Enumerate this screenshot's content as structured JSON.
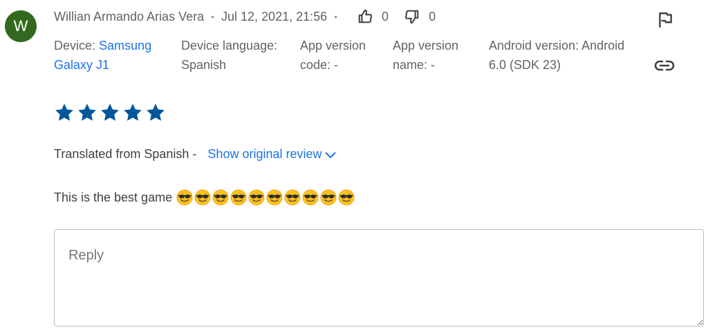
{
  "review": {
    "avatar_letter": "W",
    "author": "Willian Armando Arias Vera",
    "separator": "•",
    "date": "Jul 12, 2021, 21:56",
    "thumbs_up_count": "0",
    "thumbs_down_count": "0",
    "device_label": "Device: ",
    "device_value_1": "Samsung",
    "device_value_2": "Galaxy J1",
    "device_language_line1": "Device language:",
    "device_language_line2": "Spanish",
    "app_version_code_line1": "App version",
    "app_version_code_line2": "code: -",
    "app_version_name_line1": "App version",
    "app_version_name_line2": "name: -",
    "android_version_line1": "Android version: Android",
    "android_version_line2": "6.0 (SDK 23)",
    "rating": 5,
    "translated_from": "Translated from Spanish -",
    "show_original": "Show original review",
    "text": "This is the best game"
  },
  "reply": {
    "placeholder": "Reply"
  },
  "colors": {
    "avatar": "#33691e",
    "star": "#01579b",
    "link": "#1a73e8",
    "muted_text": "#5f6368"
  },
  "icons": [
    "thumb-up-icon",
    "thumb-down-icon",
    "flag-icon",
    "link-icon",
    "star-icon",
    "chevron-down-icon",
    "smiling-face-with-sunglasses-emoji"
  ]
}
